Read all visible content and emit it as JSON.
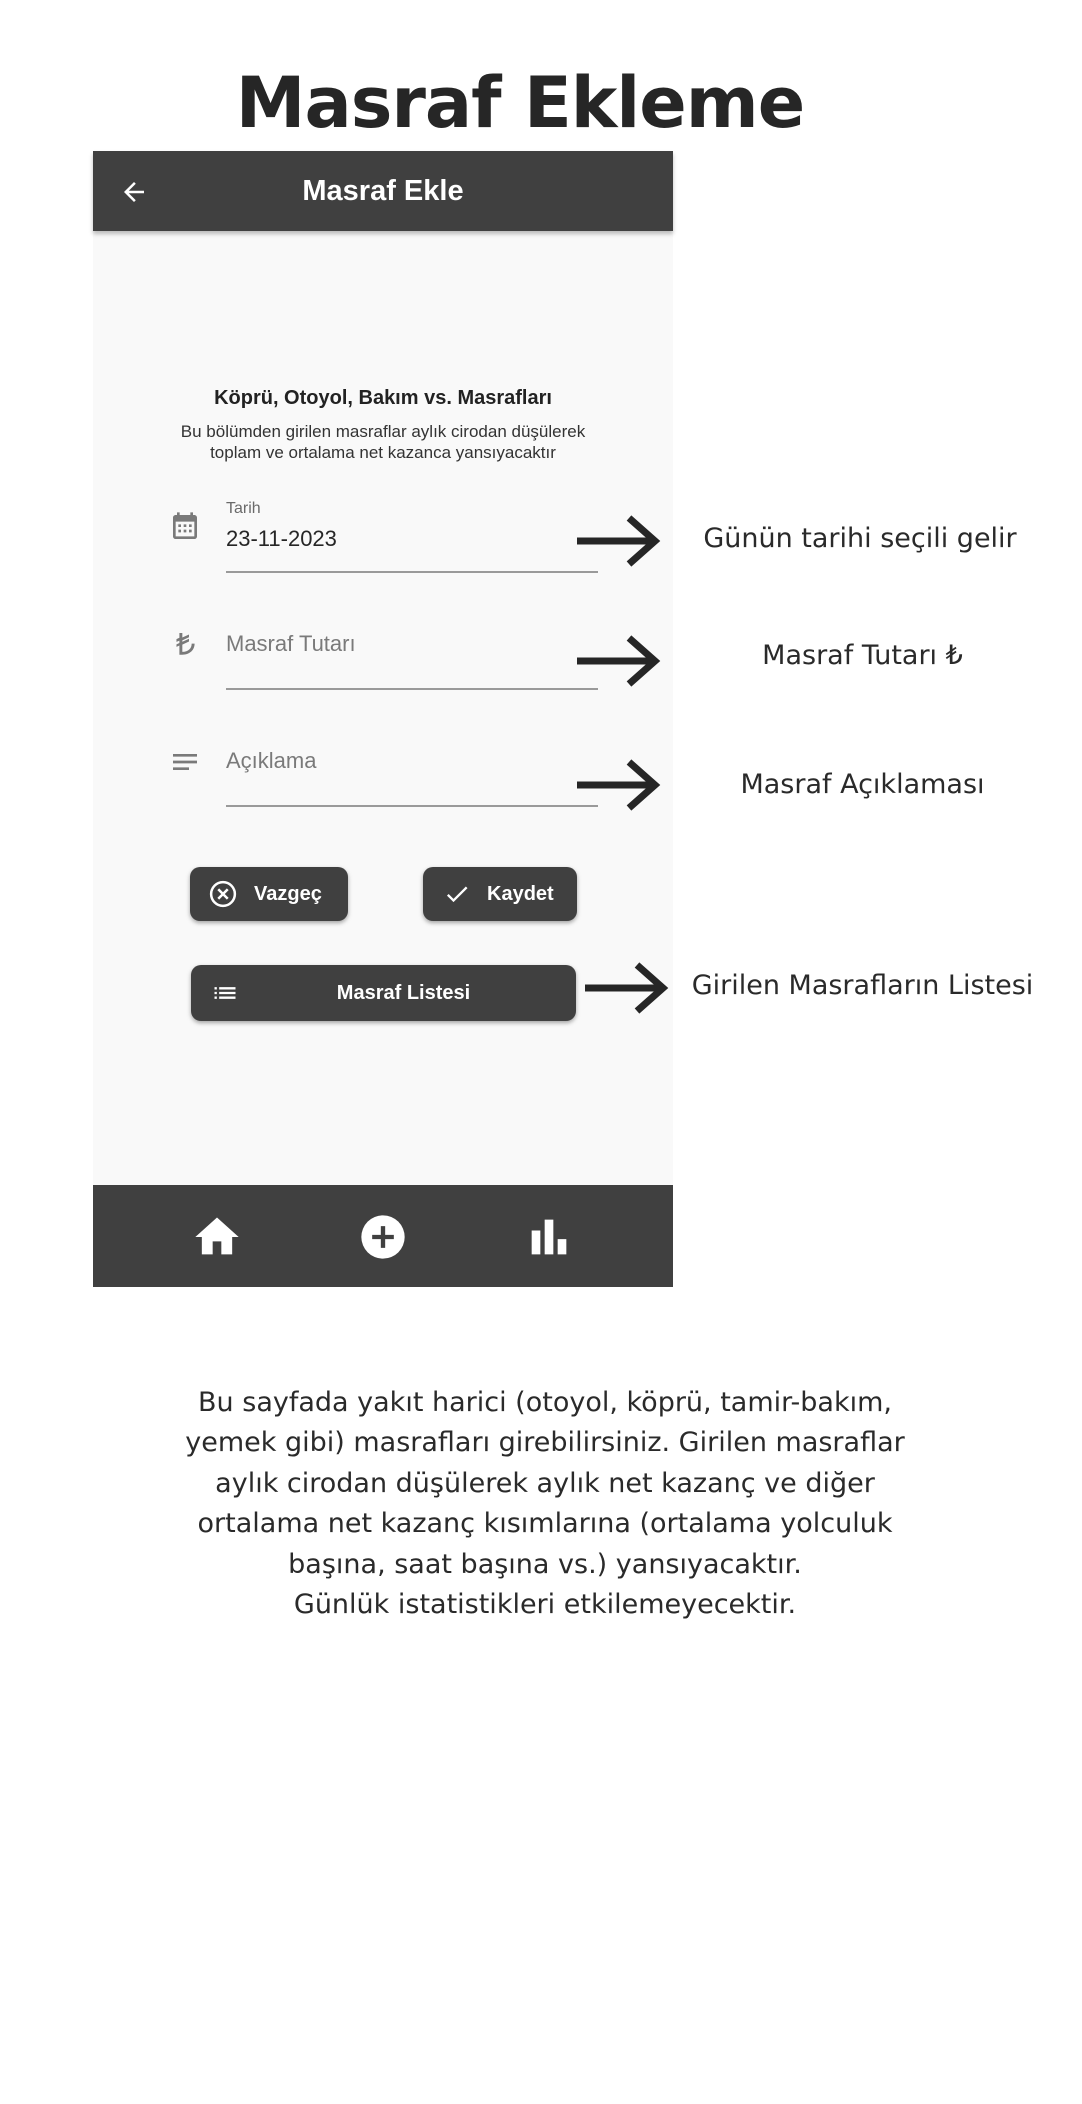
{
  "page": {
    "title": "Masraf Ekleme",
    "footer": "Bu sayfada yakıt harici (otoyol, köprü, tamir-bakım,\nyemek gibi) masrafları girebilirsiniz. Girilen masraflar\naylık cirodan düşülerek aylık net kazanç ve diğer\nortalama net kazanç kısımlarına (ortalama yolculuk\nbaşına, saat  başına vs.) yansıyacaktır.\nGünlük istatistikleri etkilemeyecektir."
  },
  "app": {
    "appbar_title": "Masraf Ekle",
    "back_icon": "arrow-back-icon",
    "section_heading": "Köprü, Otoyol, Bakım vs. Masrafları",
    "section_desc": "Bu bölümden girilen masraflar aylık cirodan düşülerek toplam ve ortalama net kazanca yansıyacaktır",
    "date_field": {
      "label": "Tarih",
      "value": "23-11-2023",
      "icon": "calendar-icon"
    },
    "amount_field": {
      "placeholder": "Masraf Tutarı",
      "icon": "lira-icon"
    },
    "desc_field": {
      "placeholder": "Açıklama",
      "icon": "notes-icon"
    },
    "buttons": {
      "cancel": "Vazgeç",
      "save": "Kaydet",
      "list": "Masraf Listesi"
    },
    "bottom_nav": [
      "home-icon",
      "add-circle-icon",
      "bar-chart-icon"
    ],
    "colors": {
      "appbar": "#404040",
      "screen_bg": "#f9f9f9",
      "button": "#404040"
    }
  },
  "annotations": {
    "date": "Günün tarihi seçili gelir",
    "amount": "Masraf Tutarı ₺",
    "description": "Masraf Açıklaması",
    "list": "Girilen Masrafların Listesi"
  }
}
